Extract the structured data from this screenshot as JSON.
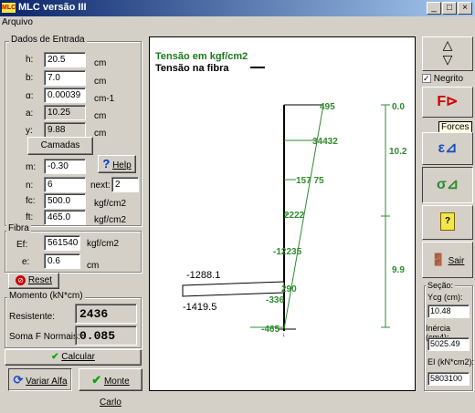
{
  "window": {
    "title": "MLC versão III",
    "app_icon_text": "MLC",
    "buttons": [
      "_",
      "□",
      "×"
    ]
  },
  "menu": {
    "arquivo": "Arquivo"
  },
  "entrada": {
    "title": "Dados de Entrada",
    "rows": [
      {
        "label": "h:",
        "value": "20.5",
        "unit": "cm"
      },
      {
        "label": "b:",
        "value": "7.0",
        "unit": "cm"
      },
      {
        "label": "α:",
        "value": "0.00039",
        "unit": "cm-1"
      },
      {
        "label": "a:",
        "value": "10.25",
        "unit": "cm"
      },
      {
        "label": "y:",
        "value": "9.88",
        "unit": "cm"
      }
    ],
    "camadas": "Camadas",
    "m_label": "m:",
    "m_value": "-0.30",
    "help": "Help",
    "help_icon": "?",
    "n_label": "n:",
    "n_value": "6",
    "next_label": "next:",
    "next_value": "2",
    "fc_label": "fc:",
    "fc_value": "500.0",
    "fc_unit": "kgf/cm2",
    "ft_label": "ft:",
    "ft_value": "465.0",
    "ft_unit": "kgf/cm2"
  },
  "fibra": {
    "title": "Fibra",
    "ef_label": "Ef:",
    "ef_value": "561540",
    "ef_unit": "kgf/cm2",
    "e_label": "e:",
    "e_value": "0.6",
    "e_unit": "cm"
  },
  "reset": "Reset",
  "momento": {
    "title": "Momento (kN*cm)",
    "resistente_label": "Resistente:",
    "resistente_value": "2436",
    "soma_label": "Soma F Normais:",
    "soma_value": "0.085"
  },
  "calcular": "Calcular",
  "variar": "Variar Alfa",
  "monte": "Monte Carlo",
  "chart_data": {
    "type": "line",
    "title": "Tensão em kgf/cm2",
    "subtitle": "Tensão na fibra",
    "labels": [
      "495",
      "34432",
      "157 75",
      "2222",
      "-12235",
      "290",
      "-336",
      "-465"
    ],
    "left_values": [
      "-1288.1",
      "-1419.5"
    ],
    "dims": [
      "0.0",
      "10.2",
      "9.9"
    ],
    "x": [
      495,
      344.32,
      157.75,
      22.22,
      -122.35,
      -336,
      -465
    ],
    "xlim": [
      -1420,
      500
    ]
  },
  "sidebar": {
    "negrito": "Negrito",
    "forces_tooltip": "Forces",
    "sair": "Sair",
    "secao_title": "Seção:",
    "ycg_label": "Ycg (cm):",
    "ycg_value": "10.48",
    "inercia_label": "Inércia (cm4):",
    "inercia_value": "5025.49",
    "ei_label": "EI (kN*cm2):",
    "ei_value": "5803100"
  },
  "colors": {
    "title_start": "#0a246a",
    "green": "#2e8b2e",
    "yellow": "#f2e84a"
  }
}
